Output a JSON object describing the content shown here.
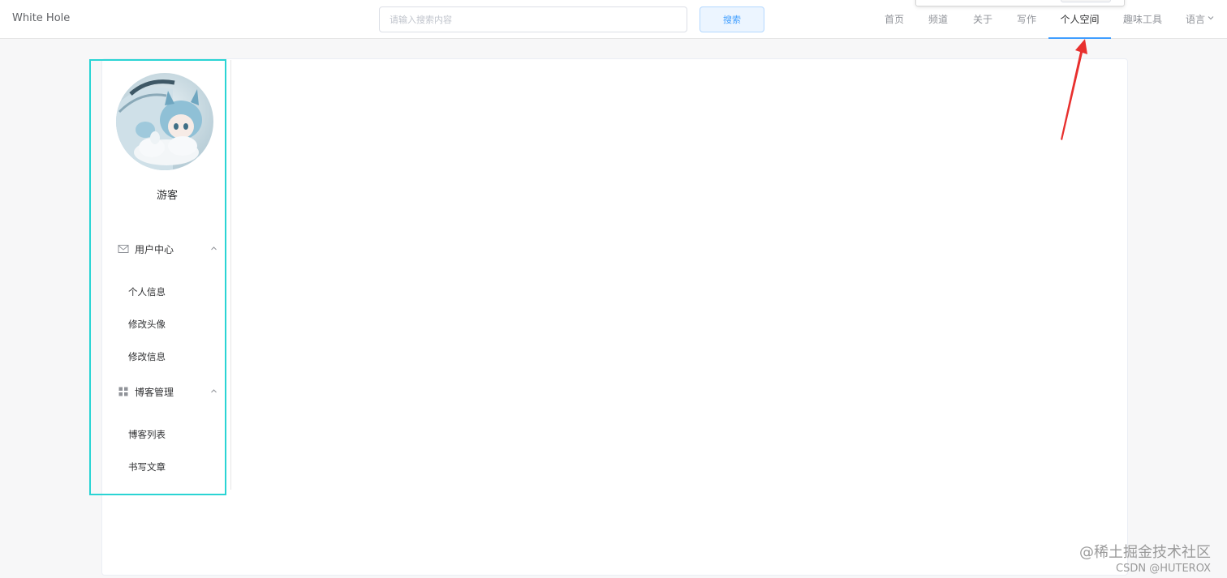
{
  "header": {
    "brand": "White Hole",
    "search": {
      "placeholder": "请输入搜索内容",
      "value": ""
    },
    "search_button": "搜索",
    "nav": [
      {
        "label": "首页"
      },
      {
        "label": "频道"
      },
      {
        "label": "关于"
      },
      {
        "label": "写作"
      },
      {
        "label": "个人空间",
        "active": true
      },
      {
        "label": "趣味工具"
      },
      {
        "label": "语言"
      }
    ]
  },
  "sidebar": {
    "username": "游客",
    "groups": [
      {
        "title": "用户中心",
        "icon": "envelope-icon",
        "expanded": true,
        "items": [
          "个人信息",
          "修改头像",
          "修改信息"
        ]
      },
      {
        "title": "博客管理",
        "icon": "grid-icon",
        "expanded": true,
        "items": [
          "博客列表",
          "书写文章"
        ]
      }
    ]
  },
  "watermark": {
    "line1": "@稀土掘金技术社区",
    "line2": "CSDN @HUTEROX"
  },
  "colors": {
    "accent": "#409eff",
    "highlight": "#2ad4d4",
    "annotation": "#e8302e"
  }
}
